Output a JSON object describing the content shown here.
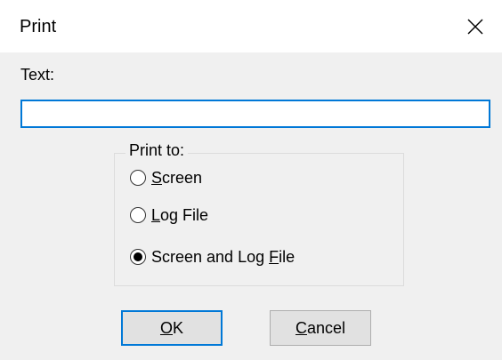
{
  "dialog": {
    "title": "Print",
    "close_symbol": "×"
  },
  "text_field": {
    "label": "Text:",
    "value": "",
    "placeholder": ""
  },
  "print_to": {
    "legend": "Print to:",
    "options": [
      {
        "pre": "",
        "key": "S",
        "post": "creen",
        "checked": false
      },
      {
        "pre": "",
        "key": "L",
        "post": "og File",
        "checked": false
      },
      {
        "pre": "Screen and Log ",
        "key": "F",
        "post": "ile",
        "checked": true
      }
    ]
  },
  "buttons": {
    "ok": {
      "pre": "",
      "key": "O",
      "post": "K"
    },
    "cancel": {
      "pre": "",
      "key": "C",
      "post": "ancel"
    }
  },
  "colors": {
    "accent": "#0078d7",
    "dialog_bg": "#f0f0f0",
    "button_bg": "#e1e1e1"
  }
}
